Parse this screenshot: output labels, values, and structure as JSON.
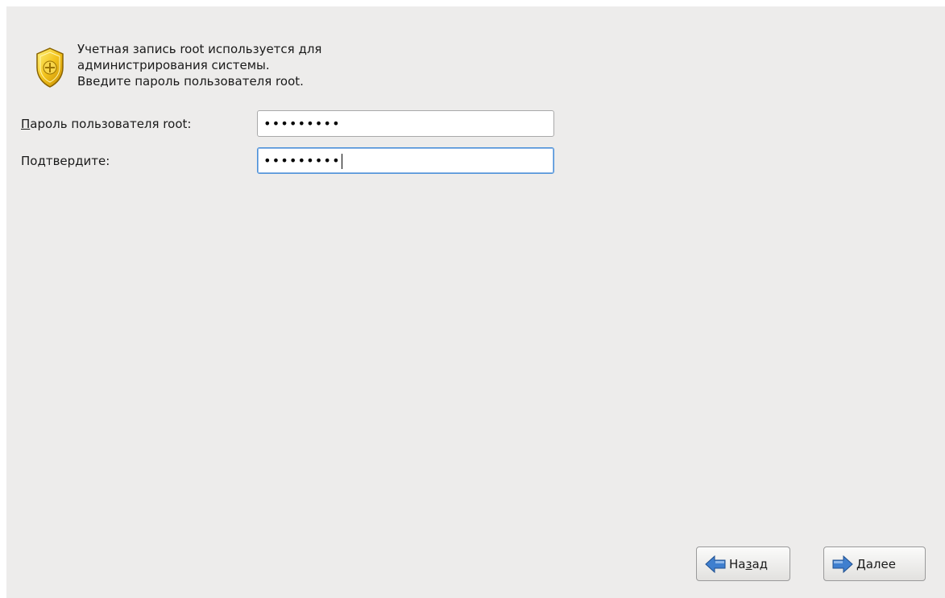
{
  "intro": {
    "line1": "Учетная запись root используется для",
    "line2": "администрирования системы.",
    "line3": "Введите пароль пользователя root."
  },
  "form": {
    "password": {
      "label_mnemonic": "П",
      "label_rest": "ароль пользователя root:",
      "value": "•••••••••"
    },
    "confirm": {
      "label_before": "Подтвер",
      "label_mnemonic": "д",
      "label_after": "ите:",
      "value": "•••••••••"
    }
  },
  "buttons": {
    "back": {
      "before": "На",
      "mnemonic": "з",
      "after": "ад",
      "icon": "arrow-left-icon"
    },
    "next": {
      "mnemonic": "Д",
      "after": "алее",
      "icon": "arrow-right-icon"
    }
  },
  "colors": {
    "background": "#edeceb",
    "focus": "#4a90d9",
    "arrow": "#3f7fcf"
  }
}
